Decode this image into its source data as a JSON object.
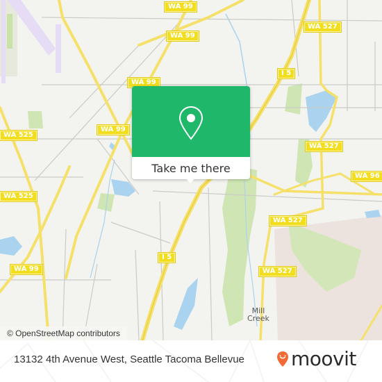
{
  "map": {
    "attribution": "© OpenStreetMap contributors",
    "route_shields": [
      {
        "id": "wa99-top",
        "label": "WA 99"
      },
      {
        "id": "wa99-a",
        "label": "WA 99"
      },
      {
        "id": "wa99-b",
        "label": "WA 99"
      },
      {
        "id": "wa99-c",
        "label": "WA 99"
      },
      {
        "id": "wa99-sw",
        "label": "WA 99"
      },
      {
        "id": "wa525-a",
        "label": "WA 525"
      },
      {
        "id": "wa525-b",
        "label": "WA 525"
      },
      {
        "id": "i5-n",
        "label": "I 5"
      },
      {
        "id": "i5-s",
        "label": "I 5"
      },
      {
        "id": "wa527-n",
        "label": "WA 527"
      },
      {
        "id": "wa527-m",
        "label": "WA 527"
      },
      {
        "id": "wa527-s1",
        "label": "WA 527"
      },
      {
        "id": "wa527-s2",
        "label": "WA 527"
      },
      {
        "id": "wa96",
        "label": "WA 96"
      }
    ],
    "places": [
      {
        "id": "mill-creek",
        "label": "Mill\nCreek",
        "line1": "Mill",
        "line2": "Creek"
      }
    ],
    "colors": {
      "background": "#f3f3ef",
      "highway": "#f5e06a",
      "water": "#a9d3ee",
      "park": "#cde6b0",
      "urban": "#eadfdc",
      "airport": "#e6dcf5"
    }
  },
  "popup": {
    "icon": "map-pin-icon",
    "button_label": "Take me there",
    "accent_color": "#1fb86a"
  },
  "footer": {
    "address": "13132 4th Avenue West, Seattle Tacoma Bellevue",
    "logo_text": "moovit",
    "logo_icon": "moovit-smiley-pin-icon",
    "logo_color": "#f26a35"
  }
}
